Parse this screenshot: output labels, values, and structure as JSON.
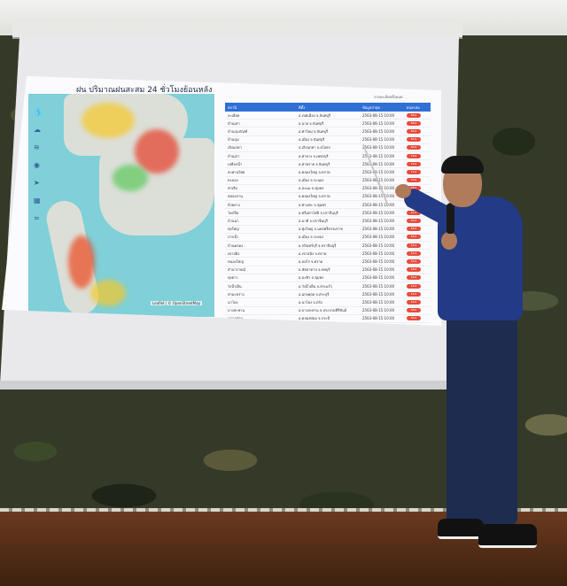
{
  "slide": {
    "title": "ฝน ปริมาณฝนสะสม 24 ชั่วโมงย้อนหลัง",
    "table_top_right": "รายละเอียดทั้งหมด",
    "map_credit": "Leaflet | © OpenStreetMap",
    "columns": [
      "สถานี",
      "ที่ตั้ง",
      "ข้อมูลล่าสุด",
      "ฝนสะสม"
    ],
    "rows": [
      [
        "ละเอียด",
        "อ.เขตเมือง จ.จันทบุรี",
        "2563-08-15 10:00",
        "88.0"
      ],
      [
        "บ้านเต่า",
        "อ.นาย จ.จันทบุรี",
        "2563-08-15 10:00",
        "88.0"
      ],
      [
        "บ้านกุมภัณฑ์",
        "อ.ท่าใหม่ จ.จันทบุรี",
        "2563-08-15 10:00",
        "86.0"
      ],
      [
        "บ้านกุม",
        "อ.เมือง จ.จันทบุรี",
        "2563-08-15 10:00",
        "84.0"
      ],
      [
        "เลิงนกทา",
        "อ.เลิงนกทา จ.ยโสธร",
        "2563-08-15 10:00",
        "80.0"
      ],
      [
        "บ้านเก่า",
        "อ.ท่ายาง จ.เพชรบุรี",
        "2563-08-15 10:00",
        "78.0"
      ],
      [
        "เปลือกน้ำ",
        "อ.ท่าทราย จ.จันทบุรี",
        "2563-08-15 10:00",
        "76.0"
      ],
      [
        "สะพานไทย",
        "อ.คลองใหญ่ จ.ตราด",
        "2563-08-15 10:00",
        "72.0"
      ],
      [
        "ตะบอง",
        "อ.เมือง จ.ระนอง",
        "2563-08-15 10:00",
        "70.0"
      ],
      [
        "ท่าเรือ",
        "อ.ละแม จ.ชุมพร",
        "2563-08-15 10:00",
        "68.0"
      ],
      [
        "คลองลาน",
        "อ.คลองใหญ่ จ.ตราด",
        "2563-08-15 10:00",
        "66.0"
      ],
      [
        "ห้วยยาง",
        "อ.ท่าแซะ จ.ชุมพร",
        "2563-08-15 10:00",
        "64.0"
      ],
      [
        "โคกปีบ",
        "อ.ศรีมหาโพธิ จ.ปราจีนบุรี",
        "2563-08-15 10:00",
        "62.0"
      ],
      [
        "บ้านนา",
        "อ.นาดี จ.ปราจีนบุรี",
        "2563-08-15 10:00",
        "60.0"
      ],
      [
        "ทุ่งใหญ่",
        "อ.ทุ่งใหญ่ จ.นครศรีธรรมราช",
        "2563-08-15 10:00",
        "58.0"
      ],
      [
        "ปากน้ำ",
        "อ.เมือง จ.ระยอง",
        "2563-08-15 10:00",
        "56.0"
      ],
      [
        "บ้านคลอง",
        "อ.กบินทร์บุรี จ.ปราจีนบุรี",
        "2563-08-15 10:00",
        "54.0"
      ],
      [
        "เขาสมิง",
        "อ.เขาสมิง จ.ตราด",
        "2563-08-15 10:00",
        "52.0"
      ],
      [
        "หนองใหญ่",
        "อ.บ่อไร่ จ.ตราด",
        "2563-08-15 10:00",
        "50.0"
      ],
      [
        "ลำนารายณ์",
        "อ.ชัยบาดาล จ.ลพบุรี",
        "2563-08-15 10:00",
        "48.0"
      ],
      [
        "ทุ่งยาว",
        "อ.ปะทิว จ.ชุมพร",
        "2563-08-15 10:00",
        "46.0"
      ],
      [
        "วังน้ำเย็น",
        "อ.วังน้ำเย็น จ.สระแก้ว",
        "2563-08-15 10:00",
        "44.0"
      ],
      [
        "ท่ามะปราง",
        "อ.แก่งคอย จ.สระบุรี",
        "2563-08-15 10:00",
        "42.0"
      ],
      [
        "นาโยง",
        "อ.นาโยง จ.ตรัง",
        "2563-08-15 10:00",
        "40.0"
      ],
      [
        "บางสะพาน",
        "อ.บางสะพาน จ.ประจวบคีรีขันธ์",
        "2563-08-15 10:00",
        "38.0"
      ],
      [
        "คลองท่อม",
        "อ.คลองท่อม จ.กระบี่",
        "2563-08-15 10:00",
        "36.0"
      ]
    ]
  }
}
